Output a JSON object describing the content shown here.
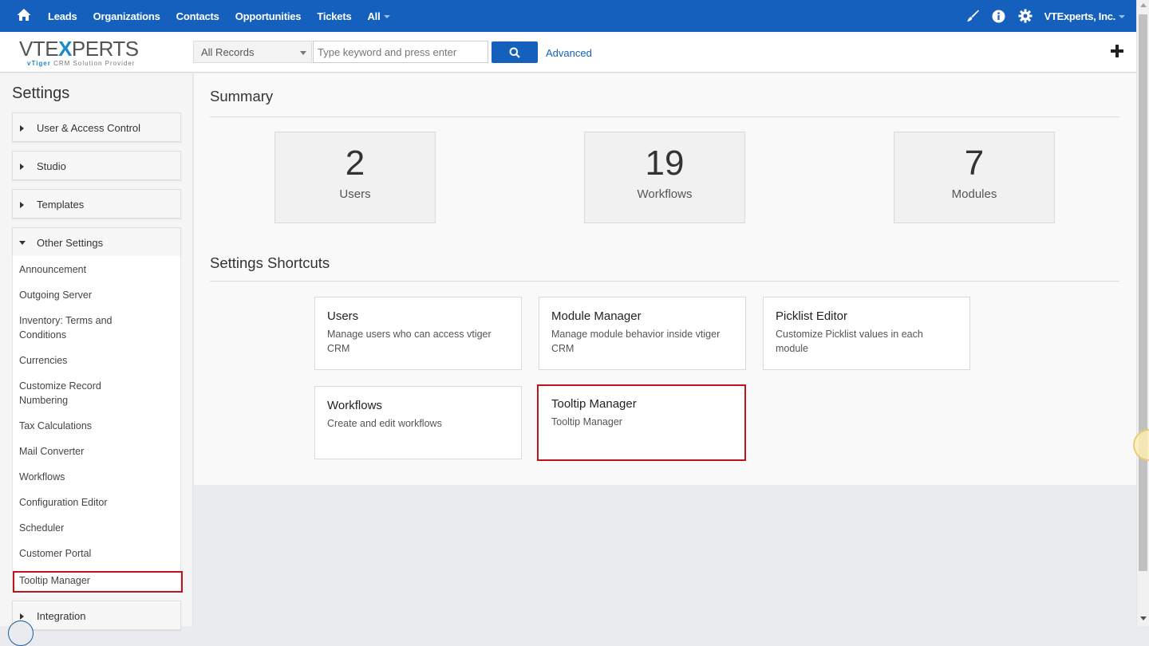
{
  "topbar": {
    "nav": [
      "Leads",
      "Organizations",
      "Contacts",
      "Opportunities",
      "Tickets",
      "All"
    ],
    "account": "VTExperts, Inc."
  },
  "logo": {
    "main_left": "VTE",
    "main_x": "X",
    "main_right": "PERTS",
    "sub_brand": "vTiger",
    "sub_text": "CRM Solution Provider"
  },
  "search": {
    "scope": "All Records",
    "placeholder": "Type keyword and press enter",
    "advanced": "Advanced"
  },
  "sidebar": {
    "title": "Settings",
    "sections": [
      {
        "label": "User & Access Control",
        "expanded": false
      },
      {
        "label": "Studio",
        "expanded": false
      },
      {
        "label": "Templates",
        "expanded": false
      },
      {
        "label": "Other Settings",
        "expanded": true
      },
      {
        "label": "Integration",
        "expanded": false
      }
    ],
    "other_settings_items": [
      "Announcement",
      "Outgoing Server",
      "Inventory: Terms and Conditions",
      "Currencies",
      "Customize Record Numbering",
      "Tax Calculations",
      "Mail Converter",
      "Workflows",
      "Configuration Editor",
      "Scheduler",
      "Customer Portal",
      "Tooltip Manager"
    ]
  },
  "summary": {
    "title": "Summary",
    "stats": [
      {
        "value": "2",
        "label": "Users"
      },
      {
        "value": "19",
        "label": "Workflows"
      },
      {
        "value": "7",
        "label": "Modules"
      }
    ]
  },
  "shortcuts": {
    "title": "Settings Shortcuts",
    "cards": [
      {
        "title": "Users",
        "desc": "Manage users who can access vtiger CRM"
      },
      {
        "title": "Module Manager",
        "desc": "Manage module behavior inside vtiger CRM"
      },
      {
        "title": "Picklist Editor",
        "desc": "Customize Picklist values in each module"
      },
      {
        "title": "Workflows",
        "desc": "Create and edit workflows"
      },
      {
        "title": "Tooltip Manager",
        "desc": "Tooltip Manager"
      }
    ]
  },
  "colors": {
    "brand": "#1560bd",
    "highlight": "#c0141c"
  },
  "icons": [
    "home-icon",
    "paintbrush-icon",
    "info-icon",
    "gear-icon",
    "search-icon",
    "plus-icon"
  ]
}
